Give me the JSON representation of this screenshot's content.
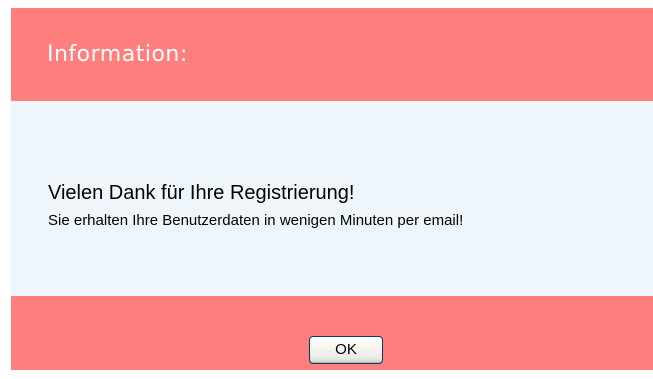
{
  "dialog": {
    "title": "Information:",
    "message_main": "Vielen Dank für Ihre Registrierung!",
    "message_sub": "Sie erhalten Ihre Benutzerdaten in wenigen Minuten per email!",
    "ok_label": "OK"
  },
  "colors": {
    "header_background": "#ff7f7f",
    "content_background": "#eef6fb",
    "footer_background": "#ff7f7f",
    "title_text": "#ffffff",
    "body_text": "#000000"
  }
}
